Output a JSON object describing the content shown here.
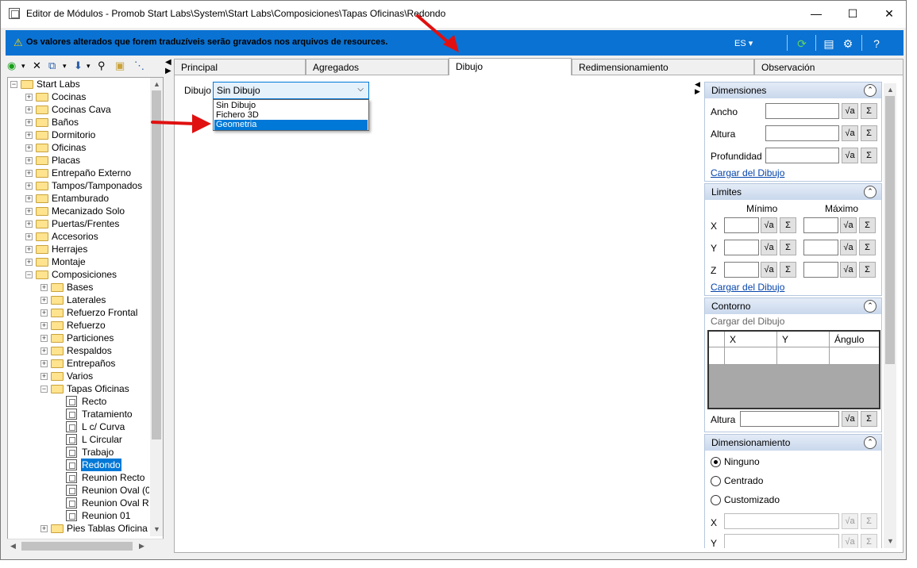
{
  "window": {
    "title": "Editor de Módulos - Promob Start Labs\\System\\Start Labs\\Composiciones\\Tapas Oficinas\\Redondo",
    "minimize": "—",
    "maximize": "☐",
    "close": "✕"
  },
  "infobar": {
    "message": "Os valores alterados que forem traduzíveis serão gravados nos arquivos de resources.",
    "language": "ES ▾",
    "bg_color": "#0a72d2"
  },
  "toolbar": {
    "icons": [
      "back-icon",
      "delete-icon",
      "copy-icon",
      "move-down-icon",
      "find-icon",
      "folder-refresh-icon",
      "tree-icon"
    ]
  },
  "tree": {
    "items": [
      {
        "label": "Start Labs",
        "level": 0,
        "type": "folder",
        "exp": "−"
      },
      {
        "label": "Cocinas",
        "level": 1,
        "type": "folder",
        "exp": "+"
      },
      {
        "label": "Cocinas Cava",
        "level": 1,
        "type": "folder",
        "exp": "+"
      },
      {
        "label": "Baños",
        "level": 1,
        "type": "folder",
        "exp": "+"
      },
      {
        "label": "Dormitorio",
        "level": 1,
        "type": "folder",
        "exp": "+"
      },
      {
        "label": "Oficinas",
        "level": 1,
        "type": "folder",
        "exp": "+"
      },
      {
        "label": "Placas",
        "level": 1,
        "type": "folder",
        "exp": "+"
      },
      {
        "label": "Entrepaño Externo",
        "level": 1,
        "type": "folder",
        "exp": "+"
      },
      {
        "label": "Tampos/Tamponados",
        "level": 1,
        "type": "folder",
        "exp": "+"
      },
      {
        "label": "Entamburado",
        "level": 1,
        "type": "folder",
        "exp": "+"
      },
      {
        "label": "Mecanizado Solo",
        "level": 1,
        "type": "folder",
        "exp": "+"
      },
      {
        "label": "Puertas/Frentes",
        "level": 1,
        "type": "folder",
        "exp": "+"
      },
      {
        "label": "Accesorios",
        "level": 1,
        "type": "folder",
        "exp": "+"
      },
      {
        "label": "Herrajes",
        "level": 1,
        "type": "folder",
        "exp": "+"
      },
      {
        "label": "Montaje",
        "level": 1,
        "type": "folder",
        "exp": "+"
      },
      {
        "label": "Composiciones",
        "level": 1,
        "type": "folder",
        "exp": "−"
      },
      {
        "label": "Bases",
        "level": 2,
        "type": "folder",
        "exp": "+"
      },
      {
        "label": "Laterales",
        "level": 2,
        "type": "folder",
        "exp": "+"
      },
      {
        "label": "Refuerzo Frontal",
        "level": 2,
        "type": "folder",
        "exp": "+"
      },
      {
        "label": "Refuerzo",
        "level": 2,
        "type": "folder",
        "exp": "+"
      },
      {
        "label": "Particiones",
        "level": 2,
        "type": "folder",
        "exp": "+"
      },
      {
        "label": "Respaldos",
        "level": 2,
        "type": "folder",
        "exp": "+"
      },
      {
        "label": "Entrepaños",
        "level": 2,
        "type": "folder",
        "exp": "+"
      },
      {
        "label": "Varios",
        "level": 2,
        "type": "folder",
        "exp": "+"
      },
      {
        "label": "Tapas Oficinas",
        "level": 2,
        "type": "folder",
        "exp": "−"
      },
      {
        "label": "Recto",
        "level": 3,
        "type": "doc"
      },
      {
        "label": "Tratamiento",
        "level": 3,
        "type": "doc"
      },
      {
        "label": "L c/ Curva",
        "level": 3,
        "type": "doc"
      },
      {
        "label": "L Circular",
        "level": 3,
        "type": "doc"
      },
      {
        "label": "Trabajo",
        "level": 3,
        "type": "doc"
      },
      {
        "label": "Redondo",
        "level": 3,
        "type": "doc",
        "selected": true
      },
      {
        "label": "Reunion Recto",
        "level": 3,
        "type": "doc"
      },
      {
        "label": "Reunion Oval (0",
        "level": 3,
        "type": "doc"
      },
      {
        "label": "Reunion Oval R",
        "level": 3,
        "type": "doc"
      },
      {
        "label": "Reunion 01",
        "level": 3,
        "type": "doc"
      },
      {
        "label": "Pies Tablas Oficina",
        "level": 2,
        "type": "folder",
        "exp": "+"
      }
    ]
  },
  "tabs": [
    {
      "label": "Principal",
      "active": false
    },
    {
      "label": "Agregados",
      "active": false
    },
    {
      "label": "Dibujo",
      "active": true
    },
    {
      "label": "Redimensionamiento",
      "active": false
    },
    {
      "label": "Observación",
      "active": false
    }
  ],
  "dibujo": {
    "label": "Dibujo",
    "selected": "Sin Dibujo",
    "options": [
      {
        "label": "Sin Dibujo",
        "selected": false
      },
      {
        "label": "Fichero 3D",
        "selected": false
      },
      {
        "label": "Geometria",
        "selected": true
      }
    ]
  },
  "dimensiones": {
    "title": "Dimensiones",
    "fields": [
      "Ancho",
      "Altura",
      "Profundidad"
    ],
    "link": "Cargar del Dibujo"
  },
  "limites": {
    "title": "Limites",
    "min_label": "Mínimo",
    "max_label": "Máximo",
    "axes": [
      "X",
      "Y",
      "Z"
    ],
    "link": "Cargar del Dibujo"
  },
  "contorno": {
    "title": "Contorno",
    "load_label": "Cargar del Dibujo",
    "columns": [
      "X",
      "Y",
      "Ángulo"
    ],
    "altura_label": "Altura"
  },
  "dimensionamiento": {
    "title": "Dimensionamiento",
    "options": [
      {
        "label": "Ninguno",
        "checked": true
      },
      {
        "label": "Centrado",
        "checked": false
      },
      {
        "label": "Customizado",
        "checked": false
      }
    ],
    "axes": [
      "X",
      "Y"
    ]
  },
  "common": {
    "formula_btn": "√a",
    "sum_btn": "Σ",
    "collapse": "⌃"
  }
}
